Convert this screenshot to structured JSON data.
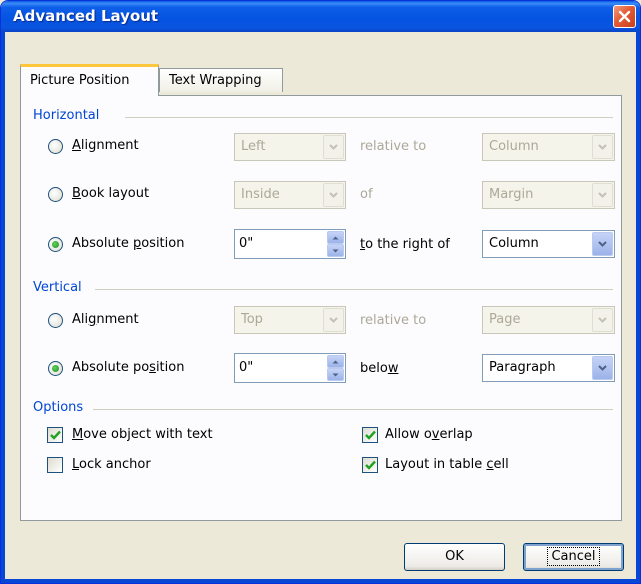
{
  "window": {
    "title": "Advanced Layout"
  },
  "tabs": [
    {
      "label": "Picture Position",
      "active": true
    },
    {
      "label": "Text Wrapping",
      "active": false
    }
  ],
  "horizontal": {
    "section_label": "Horizontal",
    "alignment": {
      "label_pre": "",
      "label_mnemonic": "A",
      "label_post": "lignment",
      "checked": false,
      "value": "Left",
      "relation": "relative to",
      "target": "Column",
      "enabled": false
    },
    "book_layout": {
      "label_pre": "",
      "label_mnemonic": "B",
      "label_post": "ook layout",
      "checked": false,
      "value": "Inside",
      "relation": "of",
      "target": "Margin",
      "enabled": false
    },
    "absolute": {
      "label_pre": "Absolute ",
      "label_mnemonic": "p",
      "label_post": "osition",
      "checked": true,
      "value": "0\"",
      "relation_mnemonic": "t",
      "relation_rest": "o the right of",
      "target": "Column",
      "enabled": true
    }
  },
  "vertical": {
    "section_label": "Vertical",
    "alignment": {
      "label_pre": "Ali",
      "label_mnemonic": "g",
      "label_post": "nment",
      "checked": false,
      "value": "Top",
      "relation": "relative to",
      "target": "Page",
      "enabled": false
    },
    "absolute": {
      "label_pre": "Absolute po",
      "label_mnemonic": "s",
      "label_post": "ition",
      "checked": true,
      "value": "0\"",
      "relation_pre": "belo",
      "relation_mnemonic": "w",
      "target": "Paragraph",
      "enabled": true
    }
  },
  "options": {
    "section_label": "Options",
    "move_object": {
      "label_pre": "",
      "label_mnemonic": "M",
      "label_post": "ove object with text",
      "checked": true
    },
    "lock_anchor": {
      "label_pre": "",
      "label_mnemonic": "L",
      "label_post": "ock anchor",
      "checked": false
    },
    "allow_overlap": {
      "label_pre": "Allow o",
      "label_mnemonic": "v",
      "label_post": "erlap",
      "checked": true
    },
    "layout_in_table": {
      "label_pre": "Layout in table ",
      "label_mnemonic": "c",
      "label_post": "ell",
      "checked": true
    }
  },
  "buttons": {
    "ok": "OK",
    "cancel": "Cancel"
  },
  "colors": {
    "section_text": "#0046d5",
    "titlebar": "#0553e1",
    "check_mark": "#21a121",
    "radio_dot": "#1f8a1f"
  },
  "icons": {
    "close": "close-icon",
    "dropdown": "chevron-down-icon",
    "spin": "spin-arrows-icon",
    "check": "check-icon"
  }
}
